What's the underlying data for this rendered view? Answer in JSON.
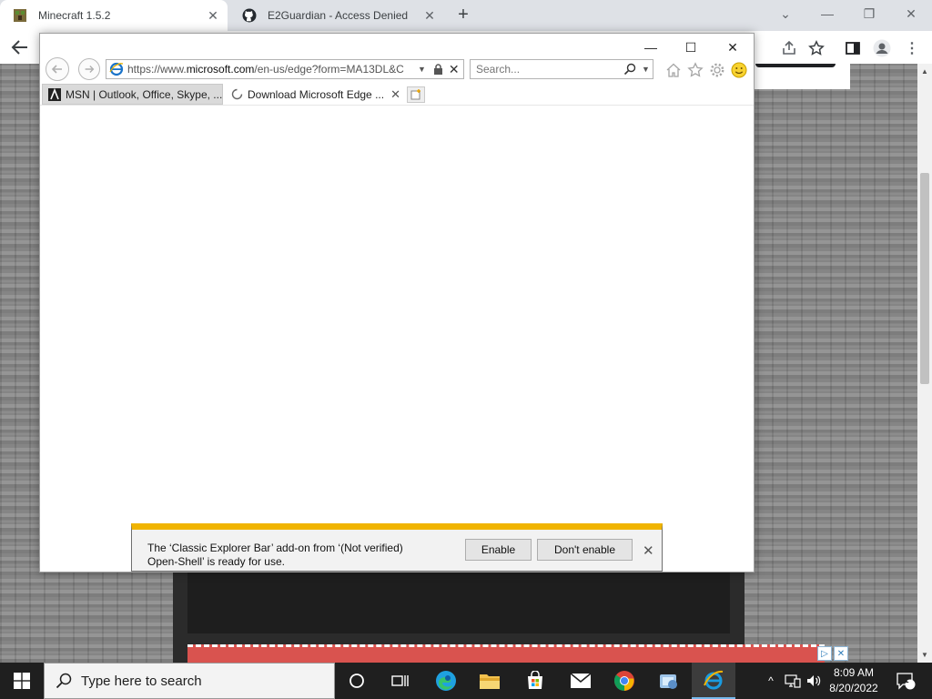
{
  "chrome": {
    "tabs": [
      {
        "title": "Minecraft 1.5.2",
        "close": "✕"
      },
      {
        "title": "E2Guardian - Access Denied",
        "close": "✕"
      }
    ],
    "new_tab": "+",
    "window_controls": {
      "dropdown": "⌄",
      "minimize": "—",
      "restore": "❐",
      "close": "✕"
    }
  },
  "ie": {
    "window_controls": {
      "minimize": "—",
      "maximize": "☐",
      "close": "✕"
    },
    "address": {
      "url_prefix": "https://www.",
      "url_domain": "microsoft.com",
      "url_rest": "/en-us/edge?form=MA13DL&C"
    },
    "search": {
      "placeholder": "Search..."
    },
    "tabs": [
      {
        "title": "MSN | Outlook, Office, Skype, ..."
      },
      {
        "title": "Download Microsoft Edge ...",
        "close": "✕"
      }
    ]
  },
  "notification": {
    "message_line1": "The ‘Classic Explorer Bar’ add-on from ‘(Not verified)",
    "message_line2": "Open-Shell’ is ready for use.",
    "enable_label": "Enable",
    "dont_enable_label": "Don't enable",
    "close": "✕"
  },
  "taskbar": {
    "search_placeholder": "Type here to search",
    "time": "8:09 AM",
    "date": "8/20/2022",
    "notification_count": "1"
  },
  "colors": {
    "notify_accent": "#f0b400",
    "taskbar": "#1f1f1f",
    "chrome_tabbar": "#dee1e6"
  }
}
